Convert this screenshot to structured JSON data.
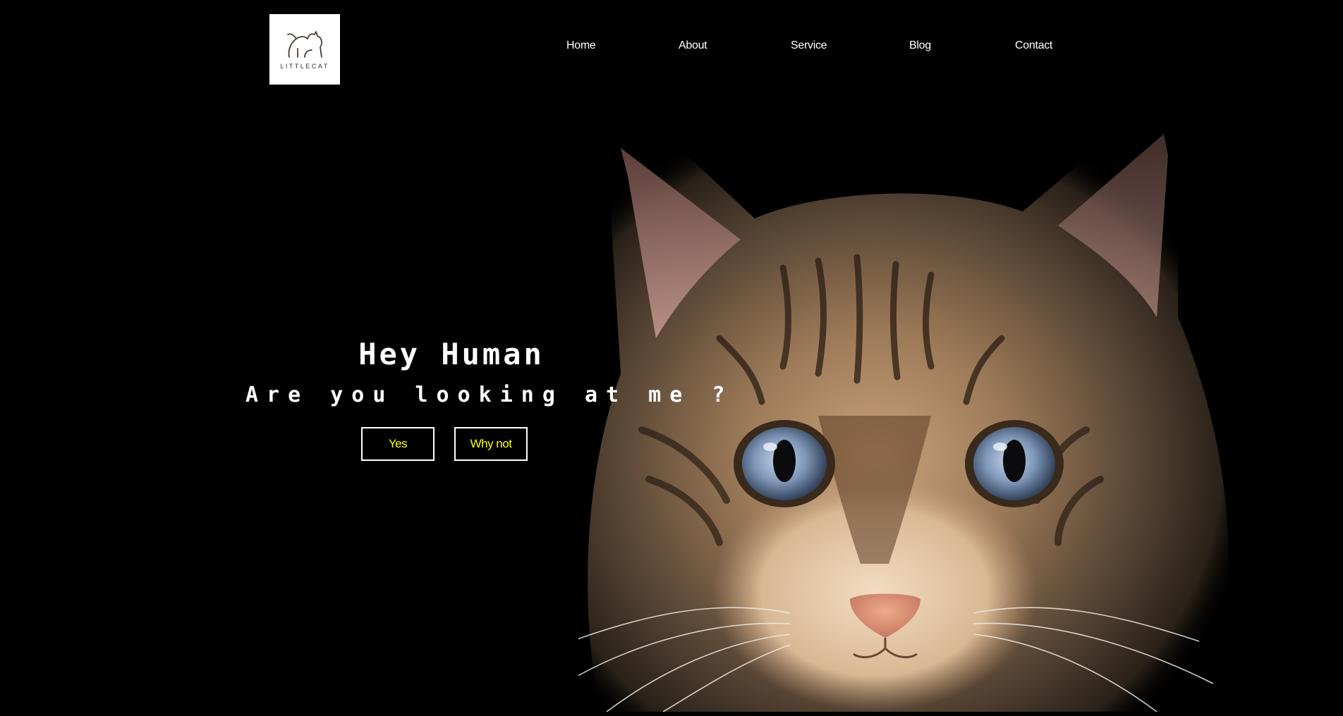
{
  "logo": {
    "text": "LITTLECAT"
  },
  "nav": {
    "items": [
      {
        "label": "Home"
      },
      {
        "label": "About"
      },
      {
        "label": "Service"
      },
      {
        "label": "Blog"
      },
      {
        "label": "Contact"
      }
    ]
  },
  "hero": {
    "title": "Hey Human",
    "subtitle": "Are you looking at me ?",
    "buttons": {
      "yes_label": "Yes",
      "why_not_label": "Why not"
    }
  },
  "colors": {
    "background": "#000000",
    "button_text": "#ffff00",
    "nav_text": "#ffffff"
  },
  "icons": {
    "logo_mark": "cat-line-icon",
    "hero_image": "tabby-cat-photo"
  }
}
